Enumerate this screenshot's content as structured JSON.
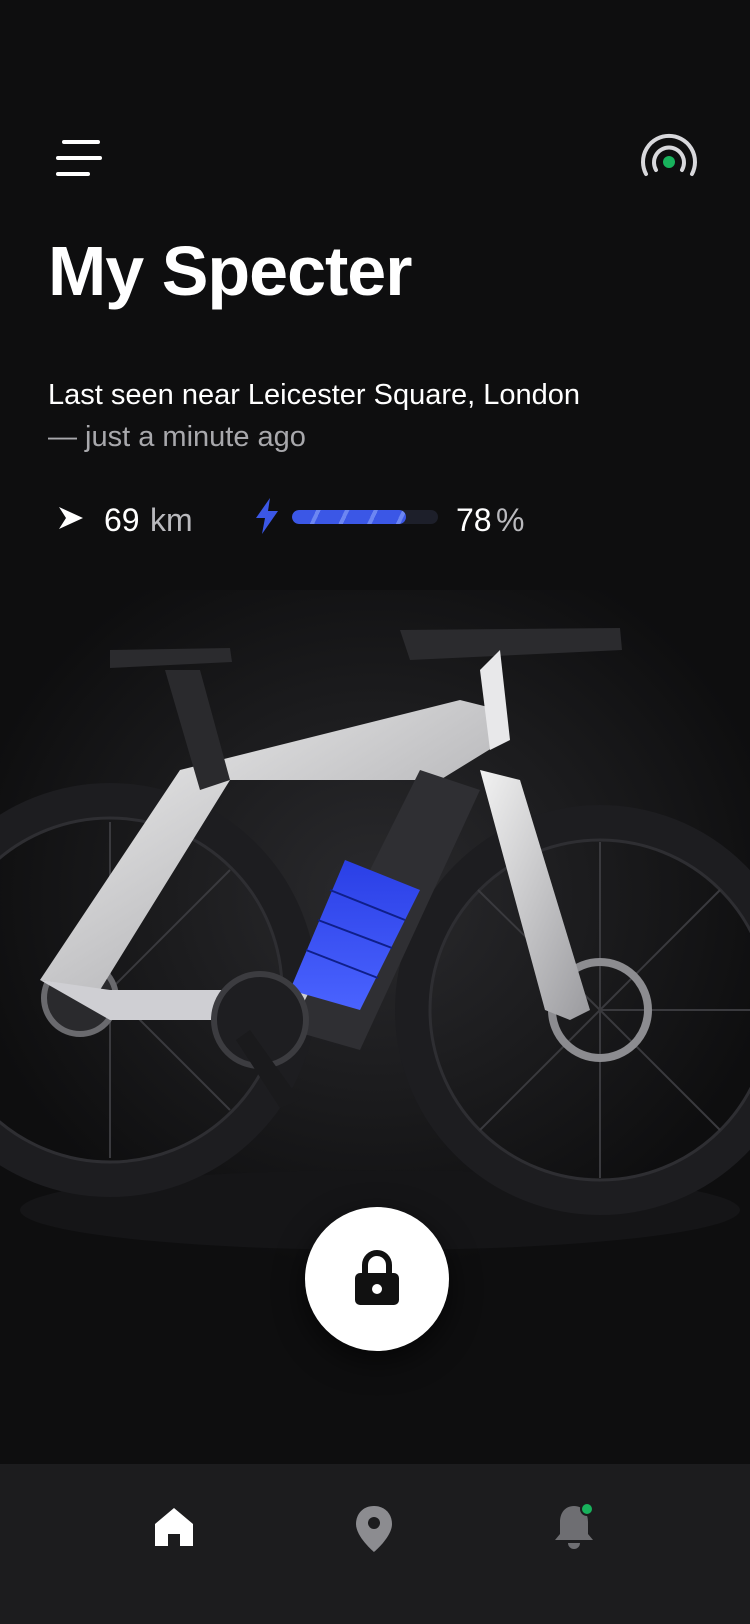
{
  "header": {
    "title": "My Specter",
    "menu_icon": "hamburger-icon",
    "connection_icon": "signal-broadcast-icon",
    "connection_status_color": "#18b25c"
  },
  "location": {
    "place": "Last seen near Leicester Square, London",
    "time": "— just a minute ago"
  },
  "stats": {
    "range_value": "69",
    "range_unit": "km",
    "battery_percent": 78,
    "battery_value": "78",
    "battery_unit": "%",
    "battery_color": "#3b57e6"
  },
  "actions": {
    "lock_icon": "lock-icon"
  },
  "nav": {
    "items": [
      {
        "icon": "home-icon",
        "active": true
      },
      {
        "icon": "map-pin-icon",
        "active": false
      },
      {
        "icon": "bell-icon",
        "active": false,
        "badge_color": "#18b25c"
      }
    ]
  }
}
